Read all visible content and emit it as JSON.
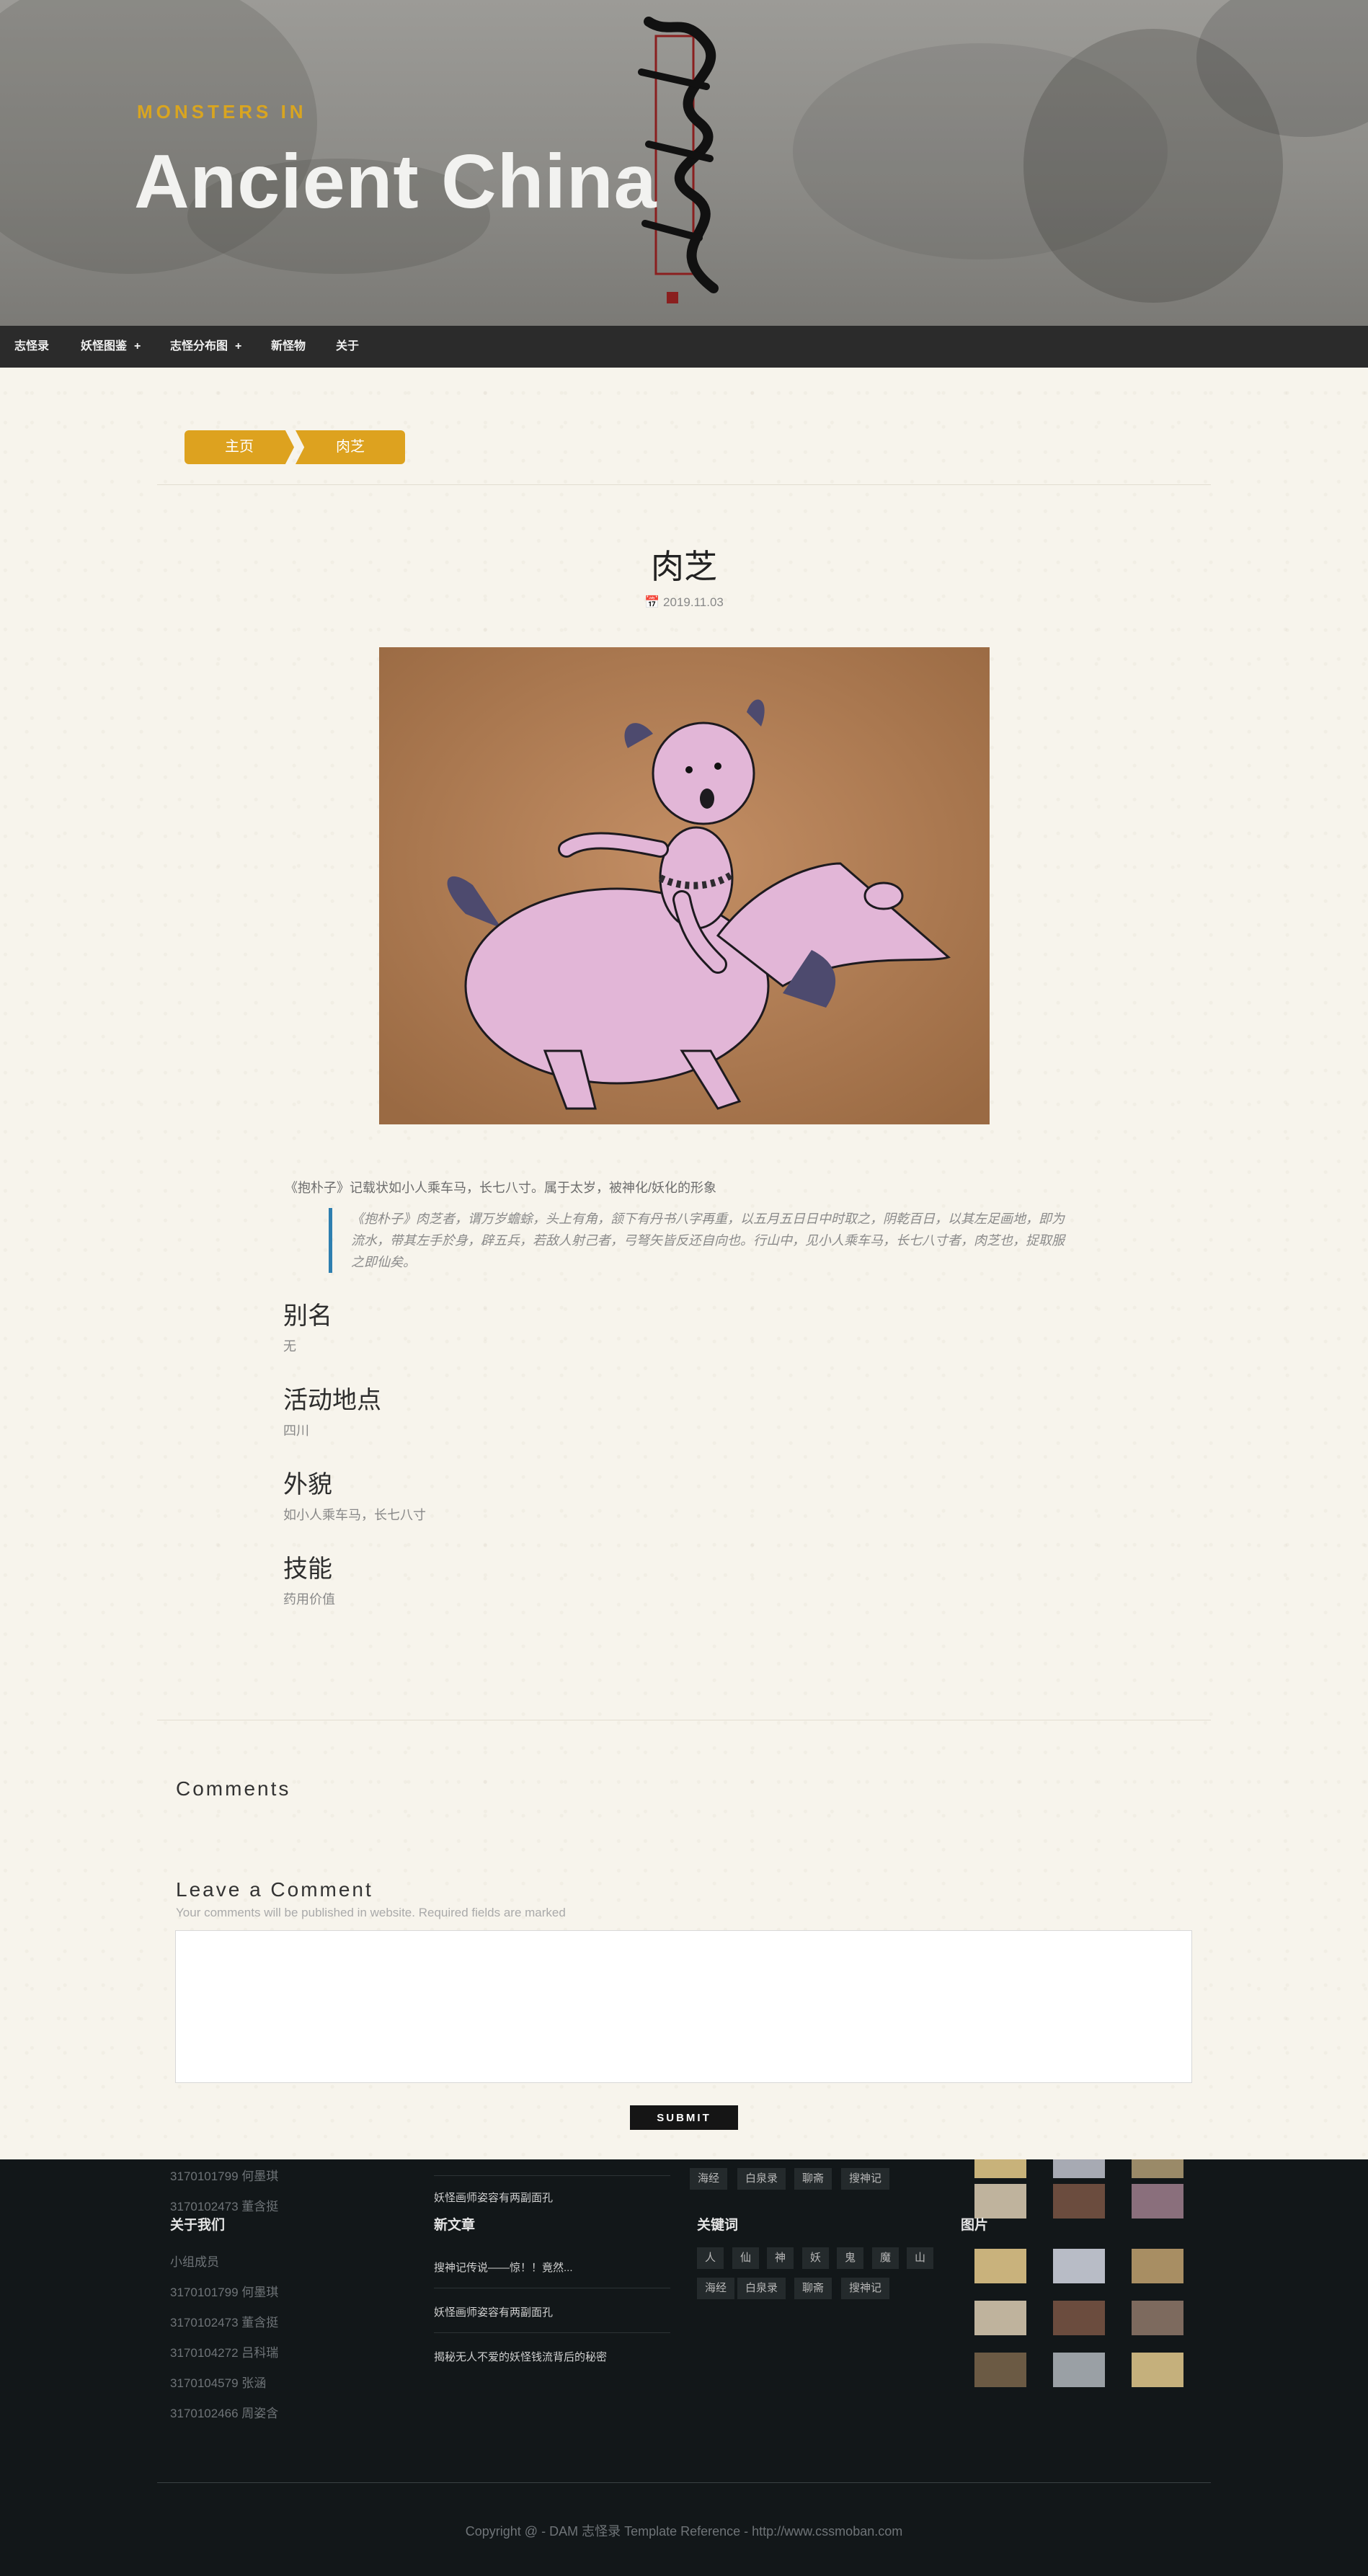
{
  "header": {
    "kicker": "MONSTERS IN",
    "title": "Ancient China",
    "logo_text": "志怪录"
  },
  "nav": {
    "items": [
      {
        "label": "志怪录",
        "has_submenu": false
      },
      {
        "label": "妖怪图鉴",
        "has_submenu": true
      },
      {
        "label": "志怪分布图",
        "has_submenu": true
      },
      {
        "label": "新怪物",
        "has_submenu": false
      },
      {
        "label": "关于",
        "has_submenu": false
      }
    ],
    "plus": "+"
  },
  "breadcrumb": {
    "home": "主页",
    "current": "肉芝"
  },
  "post": {
    "title": "肉芝",
    "date_icon": "calendar-icon",
    "date": "2019.11.03",
    "image_alt": "肉芝",
    "intro": "《抱朴子》记载状如小人乘车马，长七八寸。属于太岁，被神化/妖化的形象",
    "quote": "《抱朴子》肉芝者，谓万岁蟾蜍，头上有角，颔下有丹书八字再重，以五月五日日中时取之，阴乾百日，以其左足画地，即为流水，带其左手於身，辟五兵，若敌人射己者，弓弩矢皆反还自向也。行山中，见小人乘车马，长七八寸者，肉芝也，捉取服之即仙矣。",
    "sections": [
      {
        "heading": "别名",
        "text": "无"
      },
      {
        "heading": "活动地点",
        "text": "四川"
      },
      {
        "heading": "外貌",
        "text": "如小人乘车马，长七八寸"
      },
      {
        "heading": "技能",
        "text": "药用价值"
      }
    ]
  },
  "comments": {
    "heading": "Comments",
    "leave_heading": "Leave a Comment",
    "note": "Your comments will be published in website. Required fields are marked",
    "submit": "SUBMIT"
  },
  "footer": {
    "about": {
      "heading": "关于我们",
      "top_partial": [
        "3170101799 何墨琪",
        "3170102473 董含挺"
      ],
      "items": [
        "小组成员",
        "3170101799 何墨琪",
        "3170102473 董含挺",
        "3170104272 吕科瑞",
        "3170104579 张涵",
        "3170102466 周姿含"
      ]
    },
    "new_posts": {
      "heading": "新文章",
      "top_partial": "妖怪画师姿容有两副面孔",
      "items": [
        "搜神记传说——惊！！竟然...",
        "妖怪画师姿容有两副面孔",
        "揭秘无人不爱的妖怪钱流背后的秘密"
      ]
    },
    "keywords": {
      "heading": "关键词",
      "top_partial": [
        "海经",
        "白泉录",
        "聊斋",
        "搜神记"
      ],
      "row1": [
        "人",
        "仙",
        "神",
        "妖",
        "鬼",
        "魔",
        "山"
      ],
      "row2": [
        "海经",
        "白泉录",
        "聊斋",
        "搜神记"
      ]
    },
    "gallery": {
      "heading": "图片"
    },
    "copyright": "Copyright @ - DAM 志怪录 Template Reference - http://www.cssmoban.com"
  }
}
